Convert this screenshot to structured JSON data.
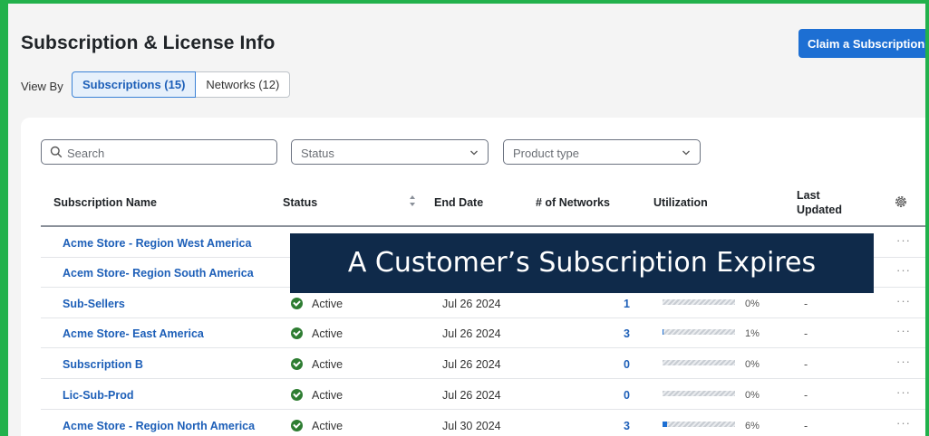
{
  "page": {
    "title": "Subscription & License Info",
    "claim_button": "Claim a Subscription"
  },
  "view_by": {
    "label": "View By",
    "options": [
      "Subscriptions (15)",
      "Networks (12)"
    ],
    "selected": "Subscriptions (15)"
  },
  "filters": {
    "search_placeholder": "Search",
    "status_placeholder": "Status",
    "product_type_placeholder": "Product type"
  },
  "table": {
    "columns": {
      "name": "Subscription Name",
      "status": "Status",
      "end_date": "End Date",
      "networks": "# of Networks",
      "utilization": "Utilization",
      "last_updated": "Last Updated"
    },
    "rows": [
      {
        "name": "Acme Store - Region West America"
      },
      {
        "name": "Acem Store- Region South America"
      },
      {
        "name": "Sub-Sellers",
        "status": "Active",
        "end_date": "Jul 26 2024",
        "networks": "1",
        "utilization": 0,
        "utilization_label": "0%",
        "last_updated": "-"
      },
      {
        "name": "Acme Store- East America",
        "status": "Active",
        "end_date": "Jul 26 2024",
        "networks": "3",
        "utilization": 1,
        "utilization_label": "1%",
        "last_updated": "-"
      },
      {
        "name": "Subscription B",
        "status": "Active",
        "end_date": "Jul 26 2024",
        "networks": "0",
        "utilization": 0,
        "utilization_label": "0%",
        "last_updated": "-"
      },
      {
        "name": "Lic-Sub-Prod",
        "status": "Active",
        "end_date": "Jul 26 2024",
        "networks": "0",
        "utilization": 0,
        "utilization_label": "0%",
        "last_updated": "-"
      },
      {
        "name": "Acme Store - Region North America",
        "status": "Active",
        "end_date": "Jul 30 2024",
        "networks": "3",
        "utilization": 6,
        "utilization_label": "6%",
        "last_updated": "-"
      }
    ],
    "more_label": "···"
  },
  "overlay": {
    "text": "A Customer’s Subscription Expires"
  },
  "colors": {
    "frame": "#22b14c",
    "primary": "#1d6fd3",
    "link": "#1d5fb8",
    "active_status": "#2e7d32",
    "overlay_bg": "#0f2a4a"
  },
  "icons": {
    "search": "search-icon",
    "chevron": "chevron-down-icon",
    "sort": "sort-icon",
    "settings": "gear-icon",
    "status": "check-circle-icon"
  }
}
